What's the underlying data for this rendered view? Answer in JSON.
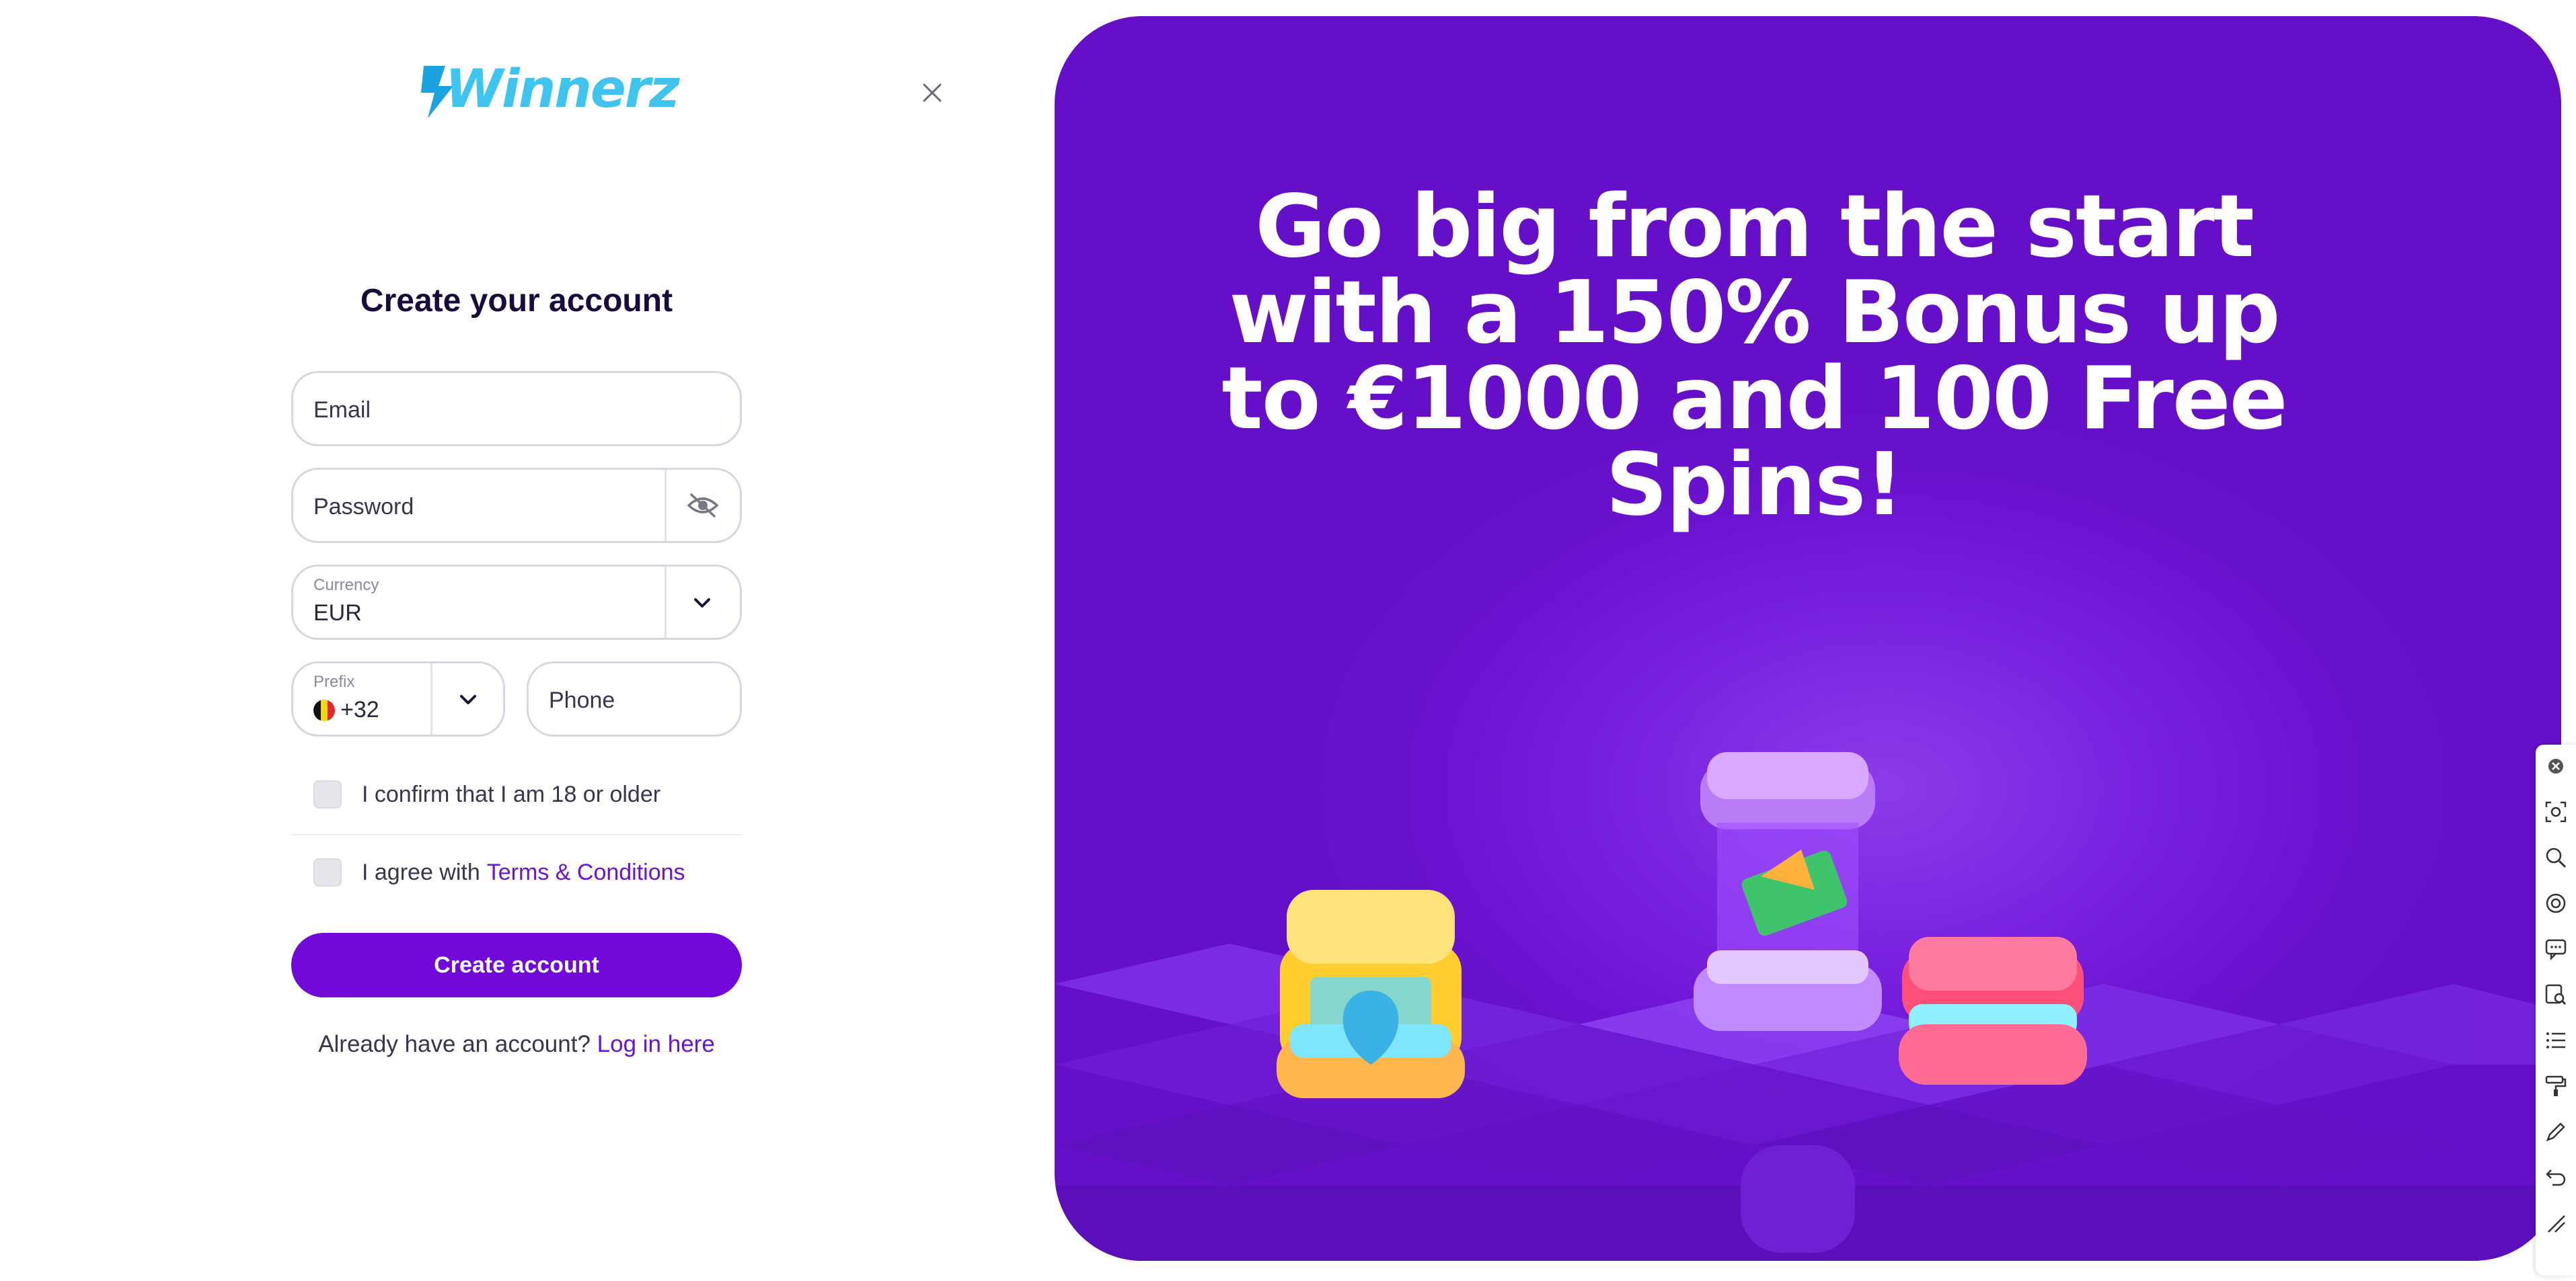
{
  "brand": {
    "name": "Winnerz",
    "color": "#3ec4ee"
  },
  "form": {
    "title": "Create your account",
    "email_placeholder": "Email",
    "password_placeholder": "Password",
    "currency_label": "Currency",
    "currency_value": "EUR",
    "prefix_label": "Prefix",
    "prefix_value": "+32",
    "phone_placeholder": "Phone",
    "age_confirm": "I confirm that I am 18 or older",
    "terms_prefix": "I agree with",
    "terms_link": "Terms & Conditions",
    "submit_label": "Create account",
    "login_prompt": "Already have an account?",
    "login_link": "Log in here"
  },
  "hero": {
    "headline": "Go big from the start with a 150% Bonus up to €1000 and 100 Free Spins!"
  },
  "colors": {
    "accent": "#7209d9",
    "link": "#6b12d6",
    "hero_bg": "#6a12cf"
  },
  "toolbar": {
    "icons": [
      "close-icon",
      "screenshot-icon",
      "search-icon",
      "camera-icon",
      "comment-icon",
      "inspect-icon",
      "list-icon",
      "paint-roller-icon",
      "pencil-icon",
      "undo-icon",
      "resize-icon"
    ]
  }
}
